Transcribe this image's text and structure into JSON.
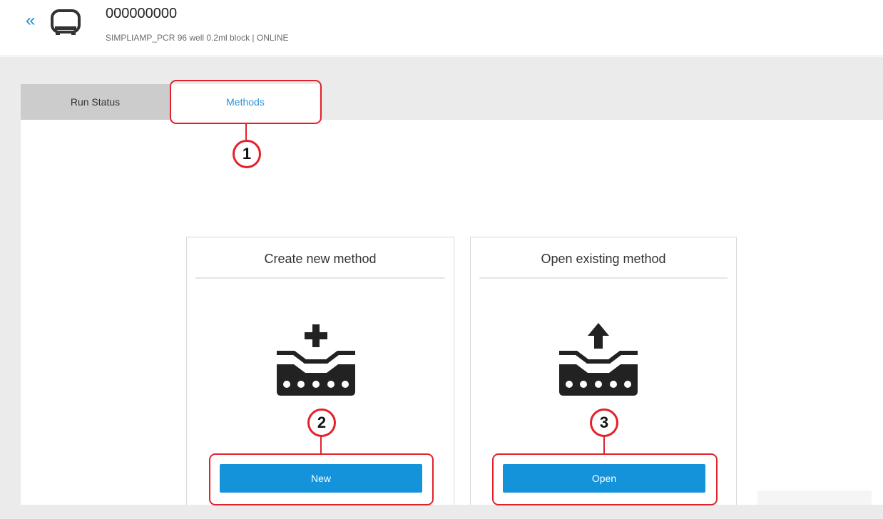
{
  "header": {
    "back_glyph": "«",
    "device_icon": "thermal-cycler-icon",
    "device_name": "000000000",
    "device_info": "SIMPLIAMP_PCR 96 well 0.2ml block | ONLINE"
  },
  "tabs": [
    {
      "label": "Run Status",
      "active": false
    },
    {
      "label": "Methods",
      "active": true
    }
  ],
  "cards": [
    {
      "title": "Create new method",
      "icon": "plate-add-icon",
      "button_label": "New"
    },
    {
      "title": "Open existing method",
      "icon": "plate-upload-icon",
      "button_label": "Open"
    }
  ],
  "callouts": [
    "1",
    "2",
    "3"
  ],
  "colors": {
    "accent": "#1493db",
    "active_tab_text": "#2b93d8",
    "inactive_tab_bg": "#cccccc",
    "page_bg": "#ebebeb",
    "highlight": "#e3212b"
  }
}
